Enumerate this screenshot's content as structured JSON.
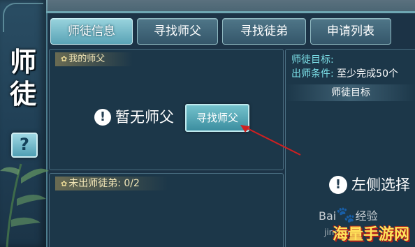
{
  "sidebar": {
    "title_char_1": "师",
    "title_char_2": "徒",
    "help_label": "?"
  },
  "tabs": [
    {
      "label": "师徒信息",
      "active": true
    },
    {
      "label": "寻找师父",
      "active": false
    },
    {
      "label": "寻找徒弟",
      "active": false
    },
    {
      "label": "申请列表",
      "active": false
    }
  ],
  "master_panel": {
    "section_label": "我的师父",
    "empty_text": "暂无师父",
    "find_button": "寻找师父"
  },
  "apprentice_panel": {
    "section_label": "未出师徒弟: 0/2"
  },
  "goal_panel": {
    "line1_label": "师徒目标:",
    "line2_label": "出师条件:",
    "line2_value": "至少完成50个",
    "header": "师徒目标",
    "empty_text": "左侧选择"
  },
  "watermark": {
    "baidu": "Bai",
    "baidu_tail": "经验",
    "baidu_sub": "jingyan",
    "site": "海量手游网"
  },
  "icons": {
    "warning": "warning-circle-icon",
    "help": "question-icon",
    "section": "flower-icon"
  },
  "colors": {
    "accent": "#7ce0e8",
    "section_text": "#f3e7b8",
    "annotation_arrow": "#d02020"
  }
}
